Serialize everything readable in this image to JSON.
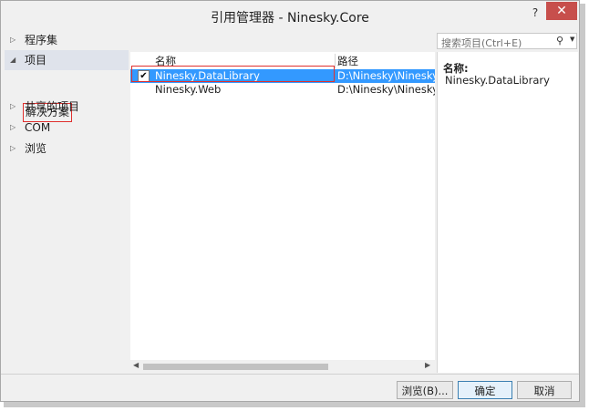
{
  "window": {
    "title": "引用管理器 - Ninesky.Core",
    "help": "?",
    "close": "✕"
  },
  "tree": {
    "items": [
      {
        "label": "程序集",
        "expanded": false
      },
      {
        "label": "项目",
        "expanded": true
      },
      {
        "label": "共享的项目",
        "expanded": false
      },
      {
        "label": "COM",
        "expanded": false
      },
      {
        "label": "浏览",
        "expanded": false
      }
    ],
    "sub_item": "解决方案"
  },
  "table": {
    "headers": {
      "name": "名称",
      "path": "路径"
    },
    "rows": [
      {
        "checked": true,
        "name": "Ninesky.DataLibrary",
        "path": "D:\\Ninesky\\Ninesky\\Nin"
      },
      {
        "checked": false,
        "name": "Ninesky.Web",
        "path": "D:\\Ninesky\\Ninesky\\Nin"
      }
    ]
  },
  "search": {
    "placeholder": "搜索项目(Ctrl+E)",
    "icon": "search-icon"
  },
  "detail": {
    "label": "名称:",
    "value": "Ninesky.DataLibrary"
  },
  "buttons": {
    "browse": "浏览(B)...",
    "ok": "确定",
    "cancel": "取消"
  },
  "colors": {
    "selection": "#3399ff",
    "highlight_box": "#e0302e",
    "close": "#c74f4c"
  }
}
